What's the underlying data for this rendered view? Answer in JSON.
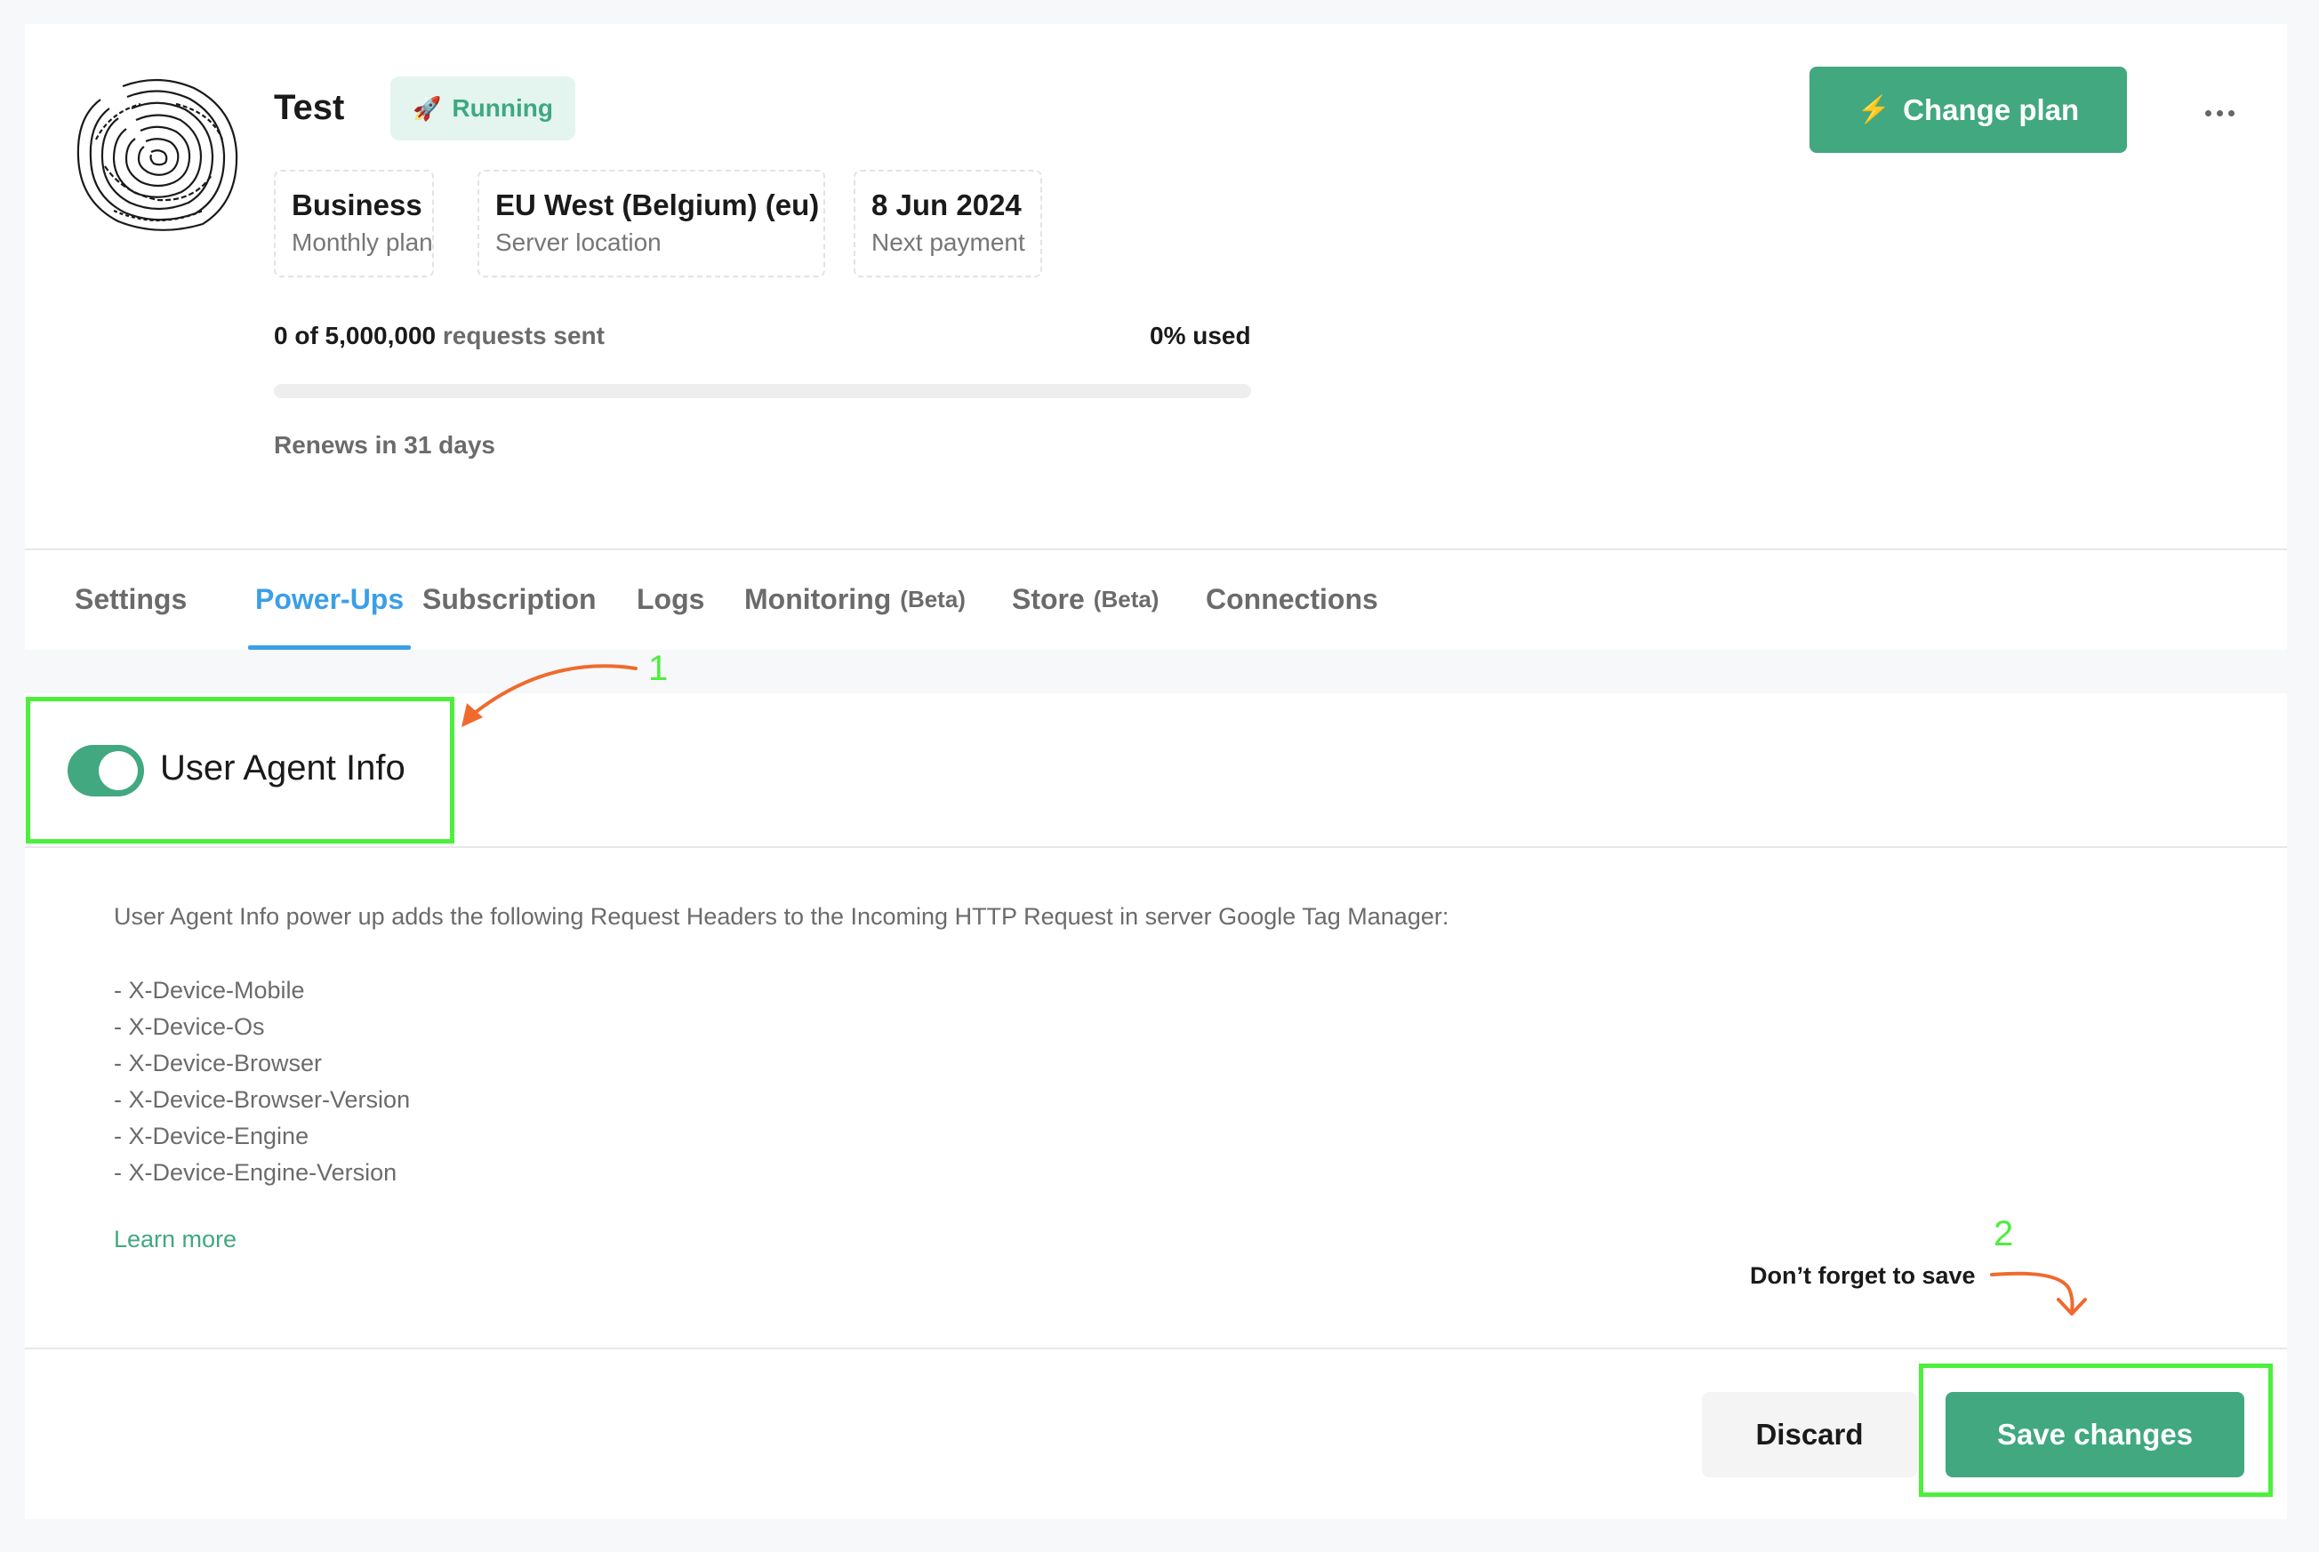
{
  "container": {
    "name": "Test",
    "status": "Running"
  },
  "info": {
    "plan": {
      "value": "Business",
      "label": "Monthly plan"
    },
    "location": {
      "value": "EU West (Belgium) (eu)",
      "label": "Server location"
    },
    "payment": {
      "value": "8 Jun 2024",
      "label": "Next payment"
    }
  },
  "usage": {
    "sent": "0 of 5,000,000",
    "sent_suffix": "requests sent",
    "used_text": "0% used",
    "used_fraction": 0,
    "renews": "Renews in 31 days"
  },
  "actions": {
    "change_plan": "Change plan"
  },
  "tabs": [
    {
      "label": "Settings"
    },
    {
      "label": "Power-Ups",
      "active": true
    },
    {
      "label": "Subscription"
    },
    {
      "label": "Logs"
    },
    {
      "label": "Monitoring",
      "badge": "(Beta)"
    },
    {
      "label": "Store",
      "badge": "(Beta)"
    },
    {
      "label": "Connections"
    }
  ],
  "powerup": {
    "title": "User Agent Info",
    "enabled": true,
    "description": "User Agent Info power up adds the following Request Headers to the Incoming HTTP Request in server Google Tag Manager:",
    "headers": [
      "- X-Device-Mobile",
      "- X-Device-Os",
      "- X-Device-Browser",
      "- X-Device-Browser-Version",
      "- X-Device-Engine",
      "- X-Device-Engine-Version"
    ],
    "learn_more": "Learn more"
  },
  "footer": {
    "discard": "Discard",
    "save": "Save changes"
  },
  "annotations": {
    "step1": "1",
    "step2": "2",
    "save_note": "Don’t forget to save"
  },
  "colors": {
    "accent_green": "#41a87f",
    "active_tab_blue": "#3b9fe6",
    "annotation_green": "#4cef3c",
    "annotation_arrow_orange": "#f06a2e"
  },
  "icons": {
    "status": "rocket-icon",
    "change_plan": "lightning-bolt-icon",
    "menu": "more-horizontal-icon"
  }
}
